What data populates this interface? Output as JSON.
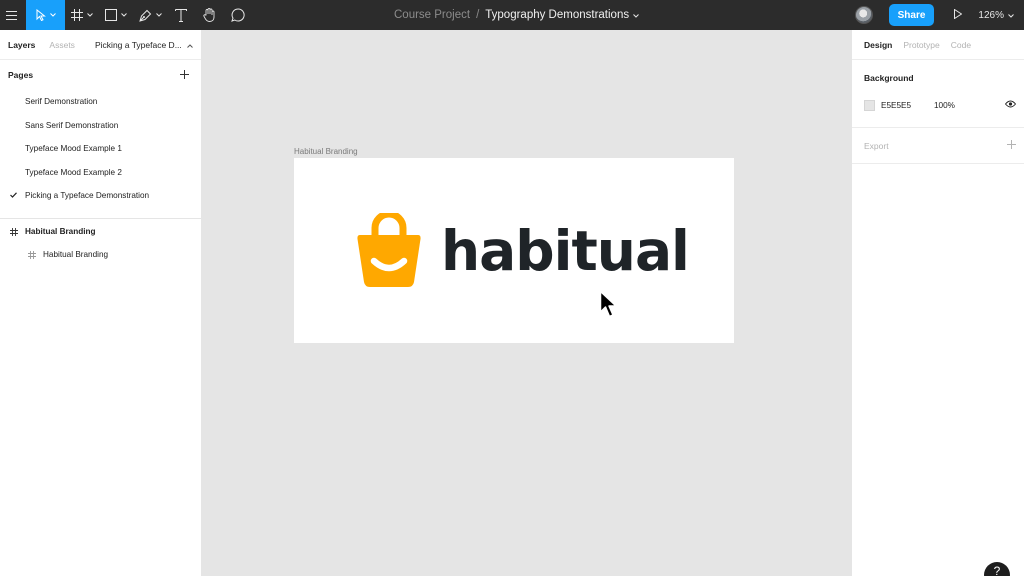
{
  "toolbar": {
    "tools": [
      "main-menu",
      "move-tool",
      "frame-tool",
      "shape-tool",
      "pen-tool",
      "text-tool",
      "hand-tool",
      "comment-tool"
    ],
    "breadcrumb": {
      "project": "Course Project",
      "separator": "/",
      "file": "Typography Demonstrations"
    },
    "share_label": "Share",
    "zoom": "126%"
  },
  "left_panel": {
    "tabs": [
      {
        "label": "Layers",
        "active": true
      },
      {
        "label": "Assets",
        "active": false
      }
    ],
    "current_page_selector": "Picking a Typeface D...",
    "pages_title": "Pages",
    "pages": [
      {
        "label": "Serif Demonstration",
        "current": false
      },
      {
        "label": "Sans Serif Demonstration",
        "current": false
      },
      {
        "label": "Typeface Mood Example 1",
        "current": false
      },
      {
        "label": "Typeface Mood Example 2",
        "current": false
      },
      {
        "label": "Picking a Typeface Demonstration",
        "current": true
      }
    ],
    "layers": [
      {
        "label": "Habitual Branding",
        "level": 0
      },
      {
        "label": "Habitual Branding",
        "level": 1
      }
    ]
  },
  "canvas": {
    "frame_label": "Habitual Branding",
    "logo_text": "habitual",
    "logo_color": "#FFA800",
    "text_color": "#1F2428"
  },
  "right_panel": {
    "tabs": [
      {
        "label": "Design",
        "active": true
      },
      {
        "label": "Prototype",
        "active": false
      },
      {
        "label": "Code",
        "active": false
      }
    ],
    "background_title": "Background",
    "background_hex": "E5E5E5",
    "background_opacity": "100%",
    "export_label": "Export"
  },
  "colors": {
    "accent": "#18A0FB",
    "toolbar": "#2C2C2C",
    "canvas": "#E5E5E5"
  },
  "help_label": "?"
}
